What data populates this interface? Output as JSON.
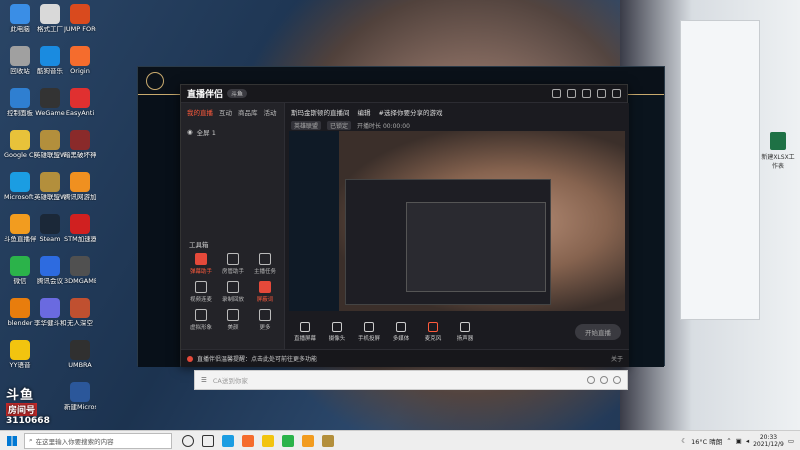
{
  "desktop": {
    "icons": [
      {
        "label": "此电脑",
        "color": "#3a8ee6"
      },
      {
        "label": "回收站",
        "color": "#a0a0a0"
      },
      {
        "label": "控制面板",
        "color": "#2f7fd1"
      },
      {
        "label": "Google Chrome",
        "color": "#e8c23a"
      },
      {
        "label": "Microsoft Edge",
        "color": "#1b9de2"
      },
      {
        "label": "斗鱼直播伴侣",
        "color": "#f29c1f"
      },
      {
        "label": "微信",
        "color": "#2bb34a"
      },
      {
        "label": "blender",
        "color": "#e87d0d"
      },
      {
        "label": "YY语音",
        "color": "#f2c40f"
      },
      {
        "label": "格式工厂",
        "color": "#d9d9d9"
      },
      {
        "label": "酷狗音乐",
        "color": "#1a8be0"
      },
      {
        "label": "WeGame",
        "color": "#333333"
      },
      {
        "label": "英雄联盟WeGame版",
        "color": "#b38f3c"
      },
      {
        "label": "英雄联盟WeGame版",
        "color": "#b38f3c"
      },
      {
        "label": "Steam",
        "color": "#1b2838"
      },
      {
        "label": "腾讯会议",
        "color": "#2d6be0"
      },
      {
        "label": "李华健斗和迷途工程",
        "color": "#6a6ae0"
      },
      {
        "label": "JUMP FORCE",
        "color": "#d94a1e"
      },
      {
        "label": "Origin",
        "color": "#f56c2d"
      },
      {
        "label": "EasyAnti",
        "color": "#e03030"
      },
      {
        "label": "暗黑破坏神",
        "color": "#8a2a2a"
      },
      {
        "label": "腾讯网游加速器",
        "color": "#f09020"
      },
      {
        "label": "STM加速器",
        "color": "#d02020"
      },
      {
        "label": "3DMGAME",
        "color": "#505050"
      },
      {
        "label": "无人深空",
        "color": "#c05030"
      },
      {
        "label": "UMBRA",
        "color": "#303030"
      },
      {
        "label": "新建Microsoft",
        "color": "#2b579a"
      }
    ]
  },
  "watermark": {
    "brand": "斗鱼",
    "label": "房间号",
    "room": "3110668"
  },
  "zb": {
    "title_logo": "直播伴侣",
    "title_badge": "斗鱼",
    "side_tabs": [
      "我的直播",
      "互动",
      "商品库",
      "活动"
    ],
    "scene_label": "全屏 1",
    "tools_title": "工具箱",
    "tools": [
      {
        "label": "弹幕助手",
        "red": true
      },
      {
        "label": "房管助手",
        "red": false
      },
      {
        "label": "主播任务",
        "red": false
      },
      {
        "label": "视频连麦",
        "red": false
      },
      {
        "label": "录制回放",
        "red": false
      },
      {
        "label": "屏蔽词",
        "red": true
      },
      {
        "label": "虚拟形象",
        "red": false
      },
      {
        "label": "美颜",
        "red": false
      },
      {
        "label": "更多",
        "red": false
      }
    ],
    "room_title": "斯玛金斯顿的直播间",
    "room_tag": "编辑",
    "room_sub": "#选择你要分享的游戏",
    "chip1": "英雄联盟",
    "chip2": "已锁定",
    "info_text": "开播时长 00:00:00",
    "bottom": [
      {
        "label": "直播屏幕",
        "red": false
      },
      {
        "label": "摄像头",
        "red": false
      },
      {
        "label": "手机投屏",
        "red": false
      },
      {
        "label": "多媒体",
        "red": false
      },
      {
        "label": "麦克风",
        "red": true
      },
      {
        "label": "扬声器",
        "red": false
      }
    ],
    "live_button": "开始直播",
    "status_text": "直播伴侣温馨提醒：点击此处可前往更多功能",
    "status_right": "关于"
  },
  "chat": {
    "placeholder": "CA送到你家"
  },
  "excel": {
    "label": "新建XLSX工作表"
  },
  "taskbar": {
    "search_placeholder": "在这里输入你要搜索的内容",
    "weather": "16°C 晴朗",
    "time": "20:33",
    "date": "2021/12/9"
  }
}
